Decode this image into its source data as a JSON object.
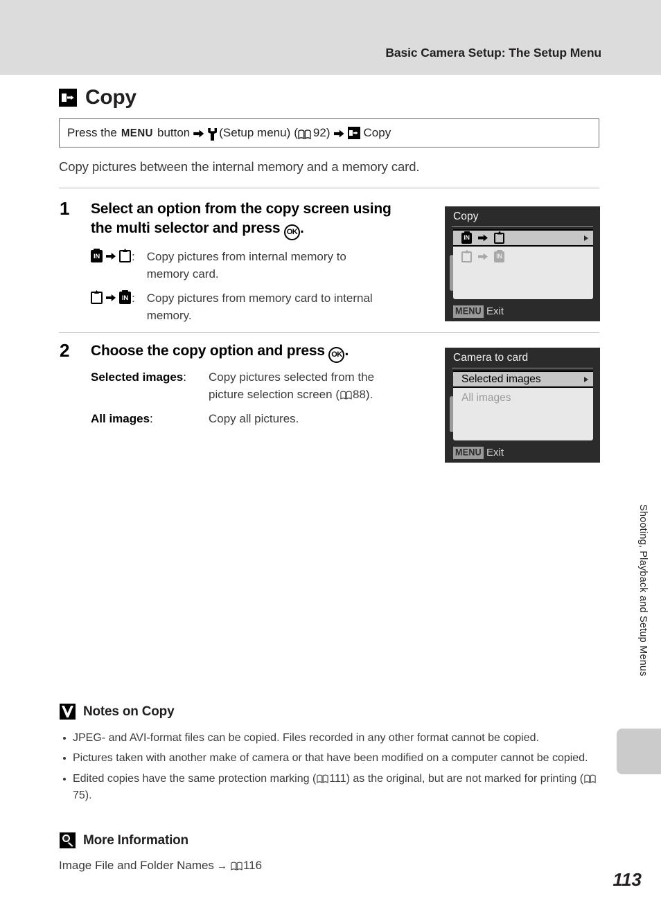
{
  "header": {
    "running_title": "Basic Camera Setup: The Setup Menu"
  },
  "section": {
    "icon": "copy-icon",
    "title": "Copy"
  },
  "nav_box": {
    "prefix": "Press the",
    "menu_glyph": "MENU",
    "button_word": "button",
    "arrow1": "➜",
    "wrench_icon": "wrench-icon",
    "setup_menu": "(Setup menu)",
    "book_icon": "book-icon",
    "page_ref": "92",
    "paren_open": "(",
    "paren_close": ")",
    "arrow2": "➜",
    "copy_icon": "copy-icon",
    "copy_label": "Copy"
  },
  "intro": "Copy pictures between the internal memory and a memory card.",
  "steps": [
    {
      "number": "1",
      "heading_part1": "Select an option from the copy screen using",
      "heading_part2": "the multi selector and press",
      "ok_glyph": "OK",
      "heading_end": ".",
      "definitions": [
        {
          "term_from": "internal-memory-icon",
          "term_arrow": "arrow-icon",
          "term_to": "memory-card-icon",
          "colon": ":",
          "desc_line1": "Copy pictures from internal memory to",
          "desc_line2": "memory card."
        },
        {
          "term_from": "memory-card-icon",
          "term_arrow": "arrow-icon",
          "term_to": "internal-memory-icon",
          "colon": ":",
          "desc_line1": "Copy pictures from memory card to internal",
          "desc_line2": "memory."
        }
      ],
      "screen": {
        "title": "Copy",
        "rows": [
          {
            "from": "internal-memory-icon",
            "to": "memory-card-icon",
            "selected": true,
            "has_caret": true
          },
          {
            "from": "memory-card-icon",
            "to": "internal-memory-icon",
            "selected": false,
            "has_caret": false
          }
        ],
        "footer_badge": "MENU",
        "footer_label": "Exit"
      }
    },
    {
      "number": "2",
      "heading_part1": "Choose the copy option and press",
      "ok_glyph": "OK",
      "heading_end": ".",
      "definitions": [
        {
          "label": "Selected images",
          "colon": ":",
          "desc_line1": "Copy pictures selected from the",
          "desc_line2_pre": "picture selection screen (",
          "desc_line2_book": "book-icon",
          "desc_line2_page": "88",
          "desc_line2_post": ")."
        },
        {
          "label": "All images",
          "colon": ":",
          "desc_line1": "Copy all pictures.",
          "desc_line2_pre": "",
          "desc_line2_page": "",
          "desc_line2_post": ""
        }
      ],
      "screen": {
        "title": "Camera to card",
        "rows": [
          {
            "label": "Selected images",
            "selected": true,
            "has_caret": true
          },
          {
            "label": "All images",
            "selected": false,
            "has_caret": false
          }
        ],
        "footer_badge": "MENU",
        "footer_label": "Exit"
      }
    }
  ],
  "notes": {
    "icon": "caution-check-icon",
    "title": "Notes on Copy",
    "items": [
      {
        "text": "JPEG- and AVI-format files can be copied. Files recorded in any other format cannot be copied."
      },
      {
        "text": "Pictures taken with another make of camera or that have been modified on a computer cannot be copied."
      },
      {
        "pre": "Edited copies have the same protection marking (",
        "ref1_page": "111",
        "mid": ") as the original, but are not marked for printing (",
        "ref2_page": "75",
        "post": ")."
      }
    ]
  },
  "more_information": {
    "icon": "magnifier-icon",
    "title": "More Information",
    "entry_text": "Image File and Folder Names",
    "arrow": "→",
    "book_icon": "book-icon",
    "entry_page": "116"
  },
  "side_tab": {
    "vertical_text": "Shooting, Playback and Setup Menus"
  },
  "page_number": "113",
  "colors": {
    "header_band": "#dcdcdc",
    "lcd_frame": "#2b2b2b",
    "lcd_body": "#e8e8e8",
    "lcd_selected_row": "#c6c6c6",
    "side_tab": "#cbcbcb",
    "rule": "#b6b7b9"
  }
}
